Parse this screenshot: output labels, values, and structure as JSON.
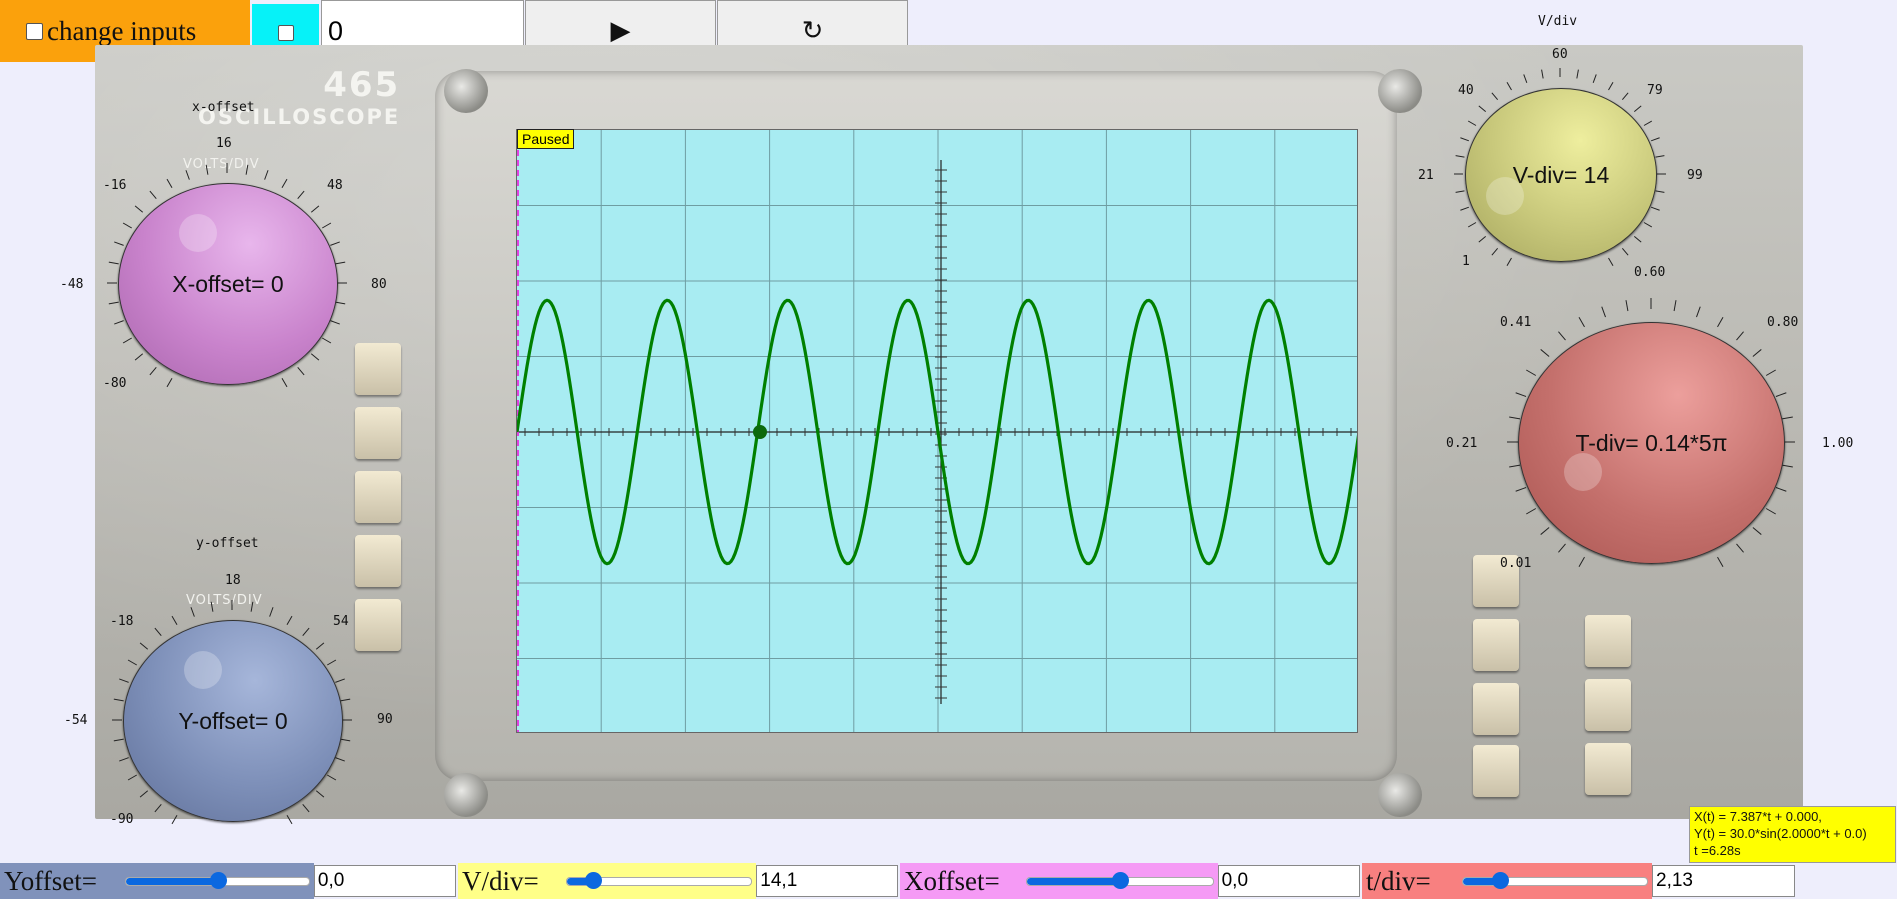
{
  "toolbar": {
    "change_inputs_label": "change inputs",
    "value_input": "0",
    "play_glyph": "▶",
    "reset_glyph": "↻"
  },
  "panel": {
    "model": "465",
    "name": "OSCILLOSCOPE",
    "volts_div_text": "VOLTS/DIV"
  },
  "screen": {
    "status": "Paused",
    "trace_color": "#008000",
    "background_color": "#a8ecf2",
    "waveform": {
      "y_amplitude": 30.0,
      "omega": 2.0,
      "x_slope": 7.387,
      "x_offset": 0.0,
      "y_offset": 0.0,
      "v_div": 14,
      "t_div_factor": 0.14,
      "t_current": 6.28
    }
  },
  "knobs": {
    "x_offset": {
      "title": "x-offset",
      "text": "X-offset= 0",
      "color": "#c983cc",
      "scale": [
        "16",
        "48",
        "80",
        "-80",
        "-48",
        "-16"
      ]
    },
    "y_offset": {
      "title": "y-offset",
      "text": "Y-offset= 0",
      "color": "#7d8fb8",
      "scale": [
        "18",
        "54",
        "90",
        "-90",
        "-54",
        "-18"
      ]
    },
    "v_div": {
      "title": "V/div",
      "text": "V-div= 14",
      "color": "#c7c77a",
      "scale": [
        "60",
        "79",
        "99",
        "1",
        "21",
        "40"
      ]
    },
    "t_div": {
      "text": "T-div= 0.14*5π",
      "color": "#c4706c",
      "scale": [
        "0.60",
        "0.80",
        "1.00",
        "0.01",
        "0.21",
        "0.41"
      ]
    }
  },
  "formula": {
    "x_eq": "X(t) = 7.387*t + 0.000,",
    "y_eq": "Y(t) = 30.0*sin(2.0000*t + 0.0)",
    "t_eq": "t =6.28s"
  },
  "controls": {
    "yoffset": {
      "label": "Yoffset=",
      "value": "0,0",
      "fraction": 0.5,
      "color": "#8092bb"
    },
    "vdiv": {
      "label": "V/div=",
      "value": "14,1",
      "fraction": 0.14,
      "color": "#ffff88"
    },
    "xoffset": {
      "label": "Xoffset=",
      "value": "0,0",
      "fraction": 0.5,
      "color": "#f59af5"
    },
    "tdiv": {
      "label": "t/div=",
      "value": "2,13",
      "fraction": 0.2,
      "color": "#f88080"
    }
  }
}
